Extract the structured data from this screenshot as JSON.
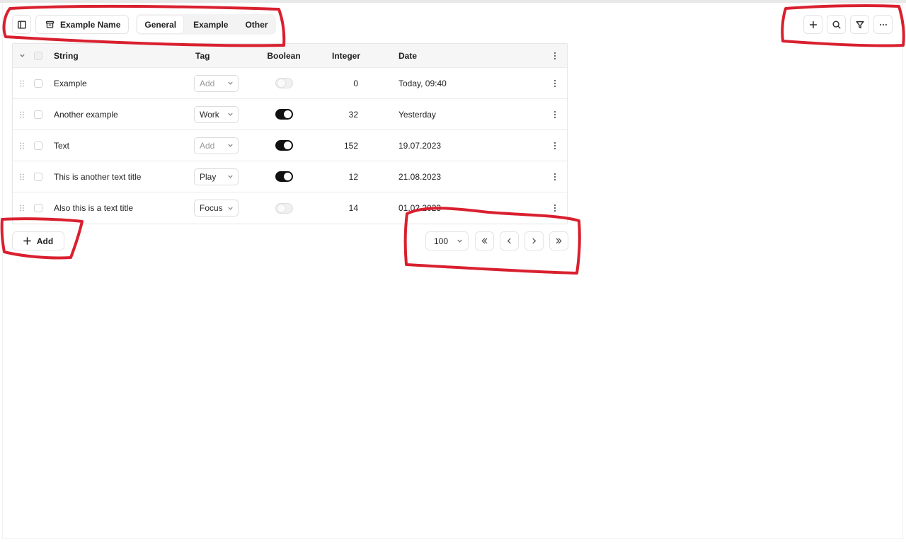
{
  "toolbar": {
    "name_button_label": "Example Name",
    "tabs": [
      {
        "label": "General",
        "active": true
      },
      {
        "label": "Example",
        "active": false
      },
      {
        "label": "Other",
        "active": false
      }
    ],
    "right_icons": [
      "plus-icon",
      "search-icon",
      "filter-icon",
      "more-horizontal-icon"
    ]
  },
  "table": {
    "columns": [
      "String",
      "Tag",
      "Boolean",
      "Integer",
      "Date"
    ],
    "rows": [
      {
        "string": "Example",
        "tag": "Add",
        "tag_is_placeholder": true,
        "boolean": false,
        "integer": "0",
        "date": "Today, 09:40"
      },
      {
        "string": "Another example",
        "tag": "Work",
        "tag_is_placeholder": false,
        "boolean": true,
        "integer": "32",
        "date": "Yesterday"
      },
      {
        "string": "Text",
        "tag": "Add",
        "tag_is_placeholder": true,
        "boolean": true,
        "integer": "152",
        "date": "19.07.2023"
      },
      {
        "string": "This is another text title",
        "tag": "Play",
        "tag_is_placeholder": false,
        "boolean": true,
        "integer": "12",
        "date": "21.08.2023"
      },
      {
        "string": "Also this is a text title",
        "tag": "Focus",
        "tag_is_placeholder": false,
        "boolean": false,
        "integer": "14",
        "date": "01.02.2023"
      }
    ]
  },
  "footer": {
    "add_label": "Add",
    "page_size": "100"
  },
  "colors": {
    "annotation": "#d9202f",
    "toggle_on": "#111111"
  }
}
